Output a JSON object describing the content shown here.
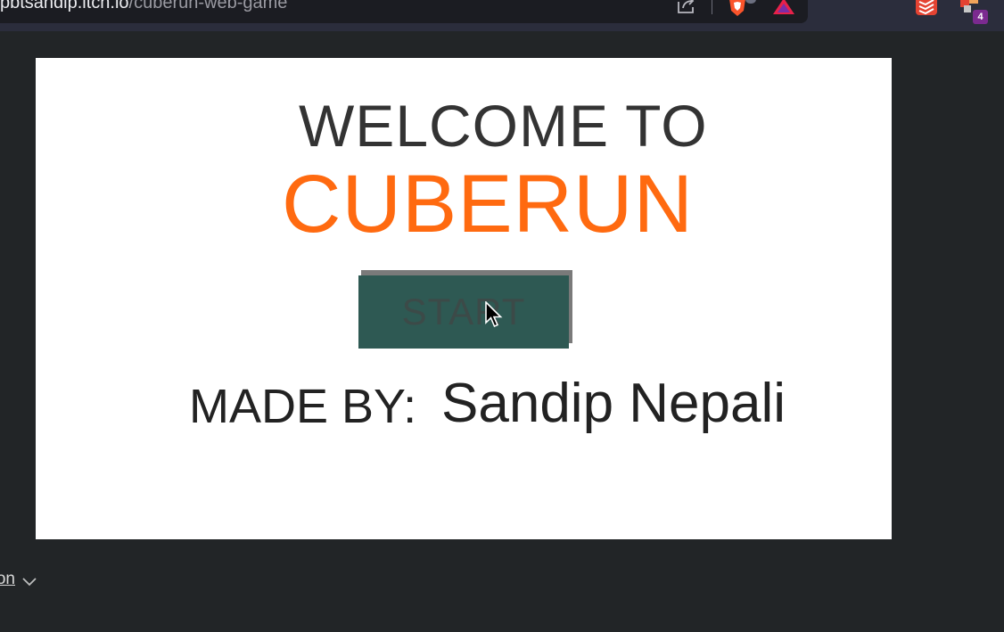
{
  "browser": {
    "url_host": "pbtsandip.itch.io",
    "url_path": "/cuberun-web-game",
    "extension_badge": "4"
  },
  "game": {
    "welcome": "WELCOME TO",
    "title": "CUBERUN",
    "start_label": "START",
    "made_by_label": "MADE BY:",
    "author": "Sandip Nepali"
  },
  "page": {
    "bottom_link": "on"
  },
  "colors": {
    "title_orange": "#ff6a10",
    "button_teal": "#2e5953",
    "page_background": "#222527"
  },
  "icons": [
    "share-icon",
    "brave-shield-icon",
    "rewards-icon",
    "todoist-icon",
    "extension-icon",
    "chevron-down-icon",
    "mouse-cursor-icon"
  ]
}
